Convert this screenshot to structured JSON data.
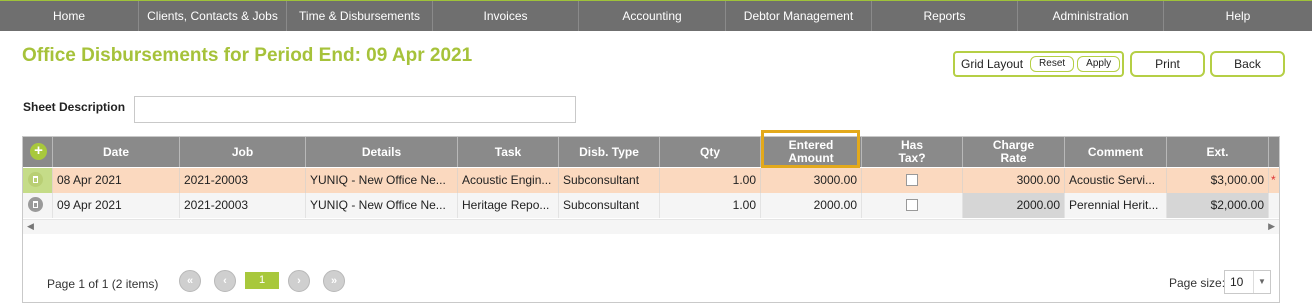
{
  "nav": {
    "items": [
      "Home",
      "Clients, Contacts & Jobs",
      "Time & Disbursements",
      "Invoices",
      "Accounting",
      "Debtor Management",
      "Reports",
      "Administration",
      "Help"
    ]
  },
  "page": {
    "title": "Office Disbursements for Period End: 09 Apr 2021"
  },
  "toolbar": {
    "grid_layout_label": "Grid Layout",
    "reset_label": "Reset",
    "apply_label": "Apply",
    "print_label": "Print",
    "back_label": "Back"
  },
  "sheet": {
    "label": "Sheet Description",
    "value": ""
  },
  "grid": {
    "headers": {
      "date": "Date",
      "job": "Job",
      "details": "Details",
      "task": "Task",
      "disb_type": "Disb. Type",
      "qty": "Qty",
      "entered_amount_1": "Entered",
      "entered_amount_2": "Amount",
      "has_tax_1": "Has",
      "has_tax_2": "Tax?",
      "charge_rate_1": "Charge",
      "charge_rate_2": "Rate",
      "comment": "Comment",
      "ext": "Ext."
    },
    "rows": [
      {
        "date": "08 Apr 2021",
        "job": "2021-20003",
        "details": "YUNIQ - New Office Ne...",
        "task": "Acoustic Engin...",
        "disb_type": "Subconsultant",
        "qty": "1.00",
        "entered_amount": "3000.00",
        "has_tax": false,
        "charge_rate": "3000.00",
        "comment": "Acoustic Servi...",
        "ext": "$3,000.00",
        "required_marker": "*"
      },
      {
        "date": "09 Apr 2021",
        "job": "2021-20003",
        "details": "YUNIQ - New Office Ne...",
        "task": "Heritage Repo...",
        "disb_type": "Subconsultant",
        "qty": "1.00",
        "entered_amount": "2000.00",
        "has_tax": false,
        "charge_rate": "2000.00",
        "comment": "Perennial Herit...",
        "ext": "$2,000.00"
      }
    ],
    "colors": {
      "selected_row": "#fbd9bf",
      "accent": "#a8c83c",
      "highlight_border": "#e3a91b"
    }
  },
  "pager": {
    "summary": "Page 1 of 1 (2 items)",
    "current_page": "1",
    "page_size_label": "Page size:",
    "page_size": "10"
  }
}
